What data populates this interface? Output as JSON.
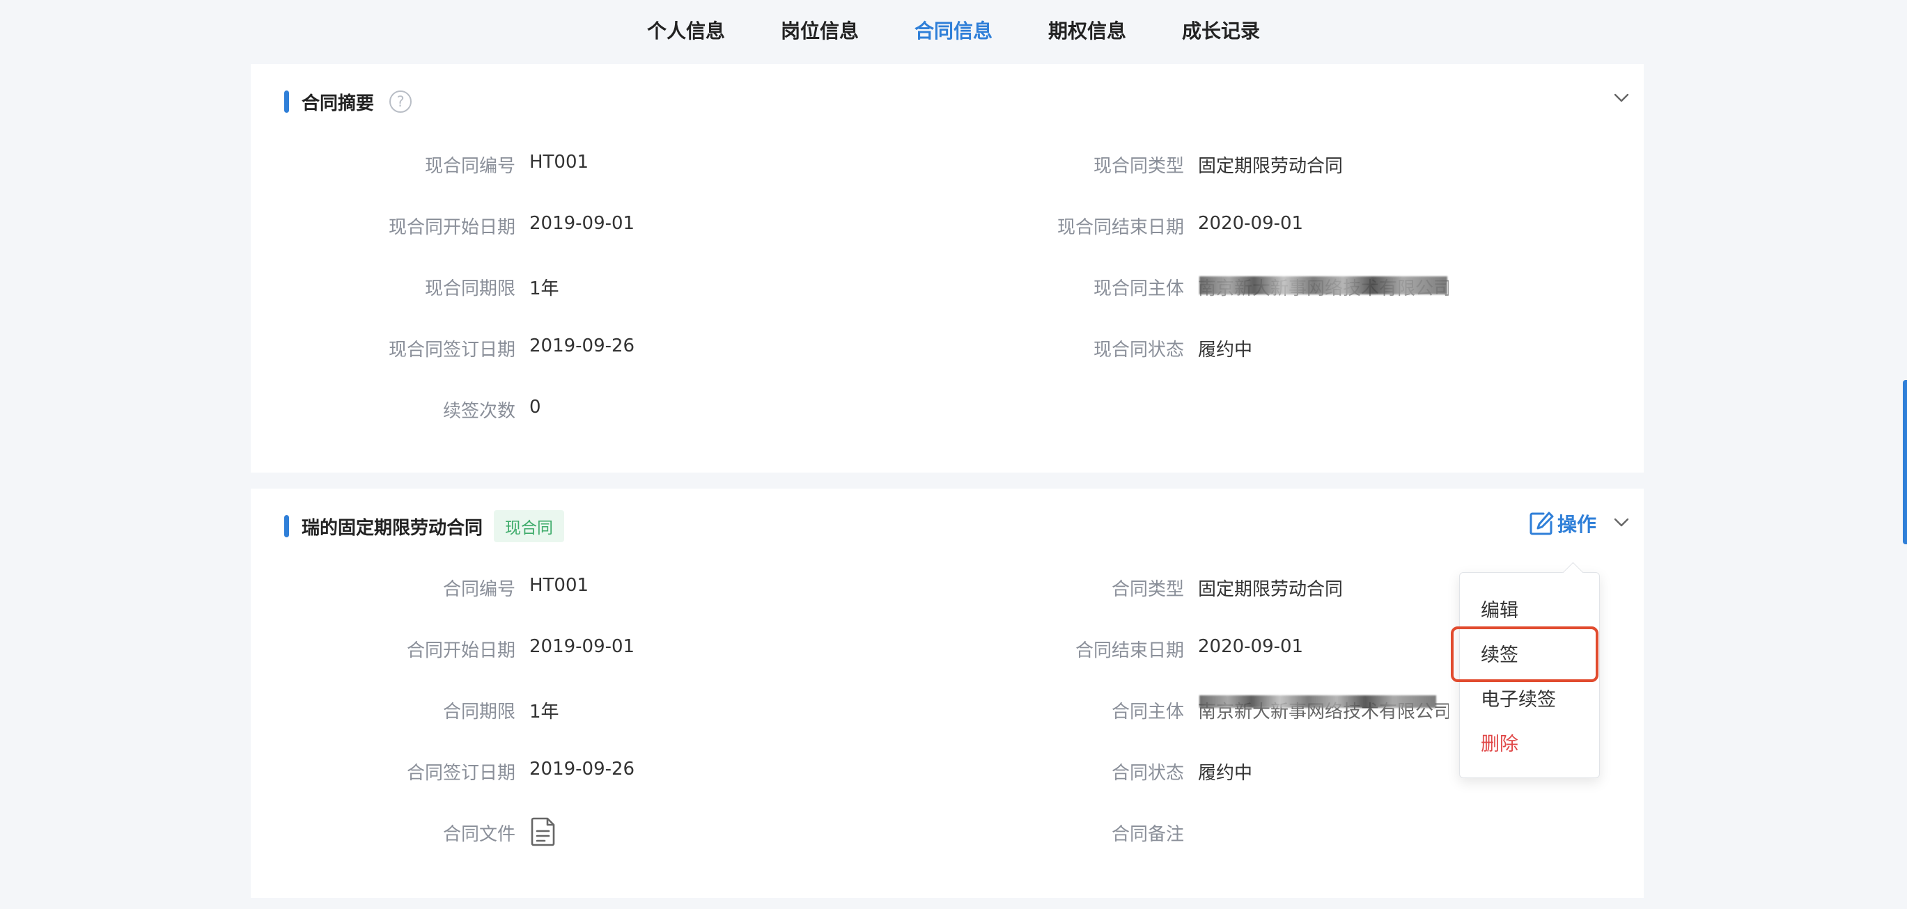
{
  "tabs": [
    "个人信息",
    "岗位信息",
    "合同信息",
    "期权信息",
    "成长记录"
  ],
  "active_tab": "合同信息",
  "summary": {
    "title": "合同摘要",
    "help_icon": "?",
    "contract_no_label": "现合同编号",
    "contract_no": "HT001",
    "contract_type_label": "现合同类型",
    "contract_type": "固定期限劳动合同",
    "start_label": "现合同开始日期",
    "start": "2019-09-01",
    "end_label": "现合同结束日期",
    "end": "2020-09-01",
    "term_label": "现合同期限",
    "term": "1年",
    "entity_label": "现合同主体",
    "entity": "南京新大新事网络技术有限公司",
    "sign_label": "现合同签订日期",
    "sign": "2019-09-26",
    "status_label": "现合同状态",
    "status": "履约中",
    "renew_count_label": "续签次数",
    "renew_count": "0"
  },
  "contract": {
    "title": "瑞的固定期限劳动合同",
    "tag": "现合同",
    "ops_label": "操作",
    "no_label": "合同编号",
    "no": "HT001",
    "type_label": "合同类型",
    "type": "固定期限劳动合同",
    "start_label": "合同开始日期",
    "start": "2019-09-01",
    "end_label": "合同结束日期",
    "end": "2020-09-01",
    "term_label": "合同期限",
    "term": "1年",
    "entity_label": "合同主体",
    "entity": "南京新大新事网络技术有限公司",
    "sign_label": "合同签订日期",
    "sign": "2019-09-26",
    "status_label": "合同状态",
    "status": "履约中",
    "file_label": "合同文件",
    "note_label": "合同备注"
  },
  "menu": {
    "edit": "编辑",
    "renew": "续签",
    "e_renew": "电子续签",
    "delete": "删除"
  },
  "colors": {
    "accent": "#2f7fd8",
    "tag_bg": "#eaf7ef",
    "tag_text": "#3dab6a",
    "danger": "#e04848",
    "highlight": "#e14b2e"
  }
}
